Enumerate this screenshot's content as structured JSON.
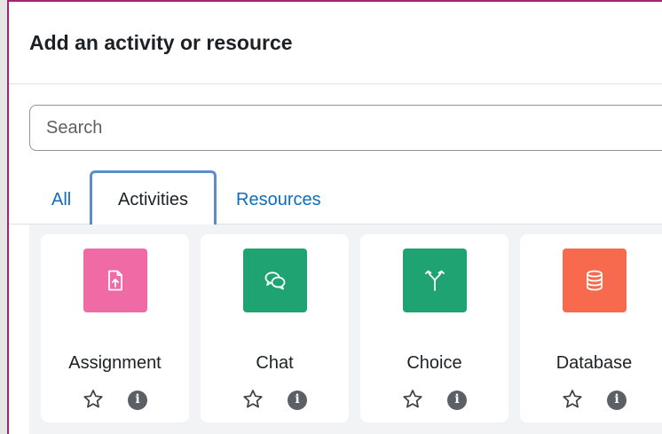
{
  "modal": {
    "title": "Add an activity or resource",
    "search_placeholder": "Search"
  },
  "tabs": [
    {
      "label": "All",
      "active": false
    },
    {
      "label": "Activities",
      "active": true
    },
    {
      "label": "Resources",
      "active": false
    }
  ],
  "cards": [
    {
      "label": "Assignment",
      "icon": "assignment-icon",
      "color": "#f06ba6"
    },
    {
      "label": "Chat",
      "icon": "chat-icon",
      "color": "#1fa373"
    },
    {
      "label": "Choice",
      "icon": "choice-icon",
      "color": "#1fa373"
    },
    {
      "label": "Database",
      "icon": "database-icon",
      "color": "#f86a4d"
    }
  ],
  "card_actions": {
    "star_icon": "star-outline-icon",
    "info_icon": "info-icon",
    "info_glyph": "i"
  },
  "colors": {
    "link": "#0f6cbf",
    "frame_accent": "#a0266f",
    "active_tab_outline": "#5b8ec7"
  }
}
